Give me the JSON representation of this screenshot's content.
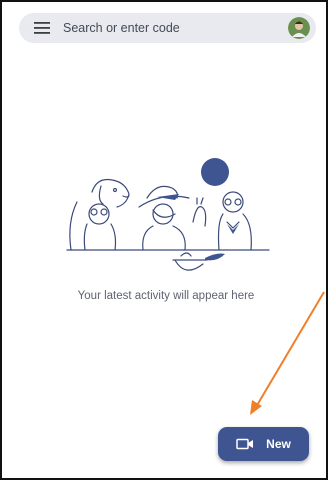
{
  "search": {
    "placeholder": "Search or enter code"
  },
  "menu_icon": "hamburger-menu-icon",
  "avatar_icon": "user-avatar",
  "empty_state": {
    "message": "Your latest activity will appear here",
    "illustration": "people-at-table-illustration"
  },
  "new_button": {
    "label": "New",
    "icon": "video-camera-icon"
  },
  "colors": {
    "search_bg": "#e8eaf0",
    "primary": "#3f5592",
    "text_muted": "#5f6370",
    "annotation_arrow": "#f07f2a",
    "illustration_line": "#3c4a7a"
  }
}
